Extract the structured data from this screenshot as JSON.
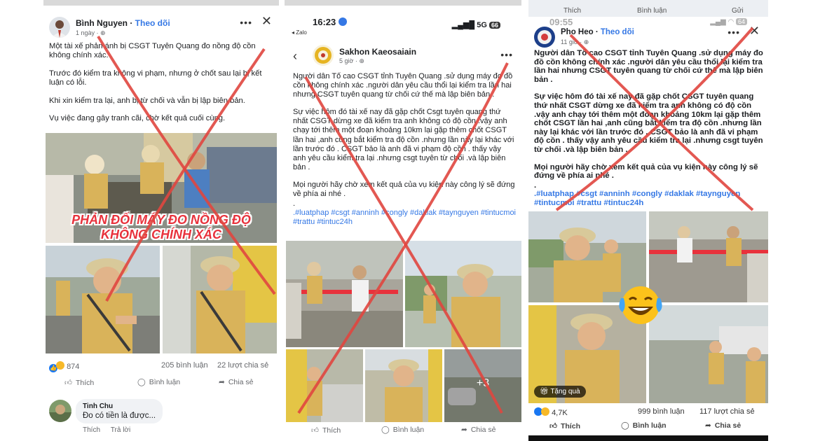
{
  "post1": {
    "author": "Bình Nguyen",
    "follow": "Theo dõi",
    "time": "1 ngày",
    "paragraphs": [
      "Một tài xế phản ánh bị CSGT Tuyên Quang đo nồng độ cồn không chính xác.",
      "Trước đó kiểm tra không vi phạm, nhưng ở chốt sau lại bị kết luận có lỗi.",
      "Khi xin kiểm tra lại, anh bị từ chối và vẫn bị lập biên bản.",
      "Vụ việc đang gây tranh cãi, chờ kết quả cuối cùng."
    ],
    "banner_line1": "PHẢN ĐỐI MÁY ĐO NỒNG ĐỘ",
    "banner_line2": "KHÔNG CHÍNH XÁC",
    "reactions": "874",
    "comments": "205 bình luận",
    "shares": "22 lượt chia sẻ",
    "like": "Thích",
    "comment": "Bình luận",
    "share": "Chia sẻ",
    "commenter": "Tinh Chu",
    "comment_text": "Đo có tiền là được...",
    "comment_like": "Thích",
    "comment_reply": "Trả lời"
  },
  "post2": {
    "clock": "16:23",
    "back_app": "◂ Zalo",
    "network": "5G",
    "battery": "66",
    "author": "Sakhon Kaeosaiain",
    "time": "5 giờ",
    "p1": "Người dân Tố cao CSGT tỉnh Tuyên Quang .sử dụng máy đo đồ cồn không chính xác .người dân yêu cầu thổi lại kiểm tra lần hai nhưng CSGT tuyên quang từ chối cứ thế mà lập biên bản .",
    "p2": "Sự việc hôm đó tài xế nay đã gặp chốt Csgt tuyên quang thứ nhất CSGT dừng xe đã kiểm tra anh không có độ cồn .vậy anh chạy tới thêm một đoạn khoảng 10km lại gặp thêm chốt CSGT lần hai ,anh cũng bắt kiểm tra độ cồn .nhưng lần này lại khác với lần trước đó . CSGT bảo là anh đã vi phạm độ cồn . thấy vậy anh yêu cầu kiểm tra lại .nhưng csgt tuyên từ chối .và lập biên bản .",
    "p3": "Mọi người hãy chờ xem kết quả của vụ kiện này công lý sẽ đứng về phía ai nhé .",
    "dot": ".",
    "hashtags": ".#luatphap #csgt #anninh #congly #daklak #taynguyen #tintucmoi #trattu #tintuc24h",
    "more_photos": "+3",
    "like": "Thích",
    "comment": "Bình luận",
    "share": "Chia sẻ"
  },
  "post3": {
    "clock": "09:55",
    "battery": "64",
    "top_like": "Thích",
    "top_comment": "Bình luận",
    "top_send": "Gửi",
    "author": "Pho Heo",
    "follow": "Theo dõi",
    "time": "11 giờ",
    "p1": "Người dân Tố cao CSGT tỉnh Tuyên Quang .sử dụng máy đo đồ cồn không chính xác .người dân yêu cầu thổi lại kiểm tra lần hai nhưng CSGT tuyên quang từ chối cứ thế mà lập biên bản .",
    "p2": "Sự việc hôm đó tài xế nay đã gặp chốt CSGT tuyên quang thứ nhất CSGT dừng xe đã kiểm tra anh không có độ cồn .vậy anh chạy tới thêm một đoạn khoảng 10km lại gặp thêm chốt CSGT lần hai ,anh cũng bắt kiểm tra độ cồn .nhưng lần này lại khác với lần trước đó . CSGT bảo là anh đã vi phạm độ cồn . thấy vậy anh yêu cầu kiểm tra lại .nhưng csgt tuyên từ chối .và lập biên bản .",
    "p3": "Mọi người hãy chờ xem kết quả của vụ kiện này công lý sẽ đứng về phía ai nhé .",
    "dot": ".",
    "hashtags": ".#luatphap #csgt #anninh #congly #daklak #taynguyen #tintucmoi #trattu #tintuc24h",
    "gift": "Tặng quà",
    "reactions": "4,7K",
    "comments": "999 bình luận",
    "shares": "117 lượt chia sẻ",
    "like": "Thích",
    "comment": "Bình luận",
    "share": "Chia sẻ"
  },
  "colors": {
    "link": "#3578e5",
    "cross": "#e0463f",
    "uniform": "#d9b35a",
    "banner": "#e8323c"
  }
}
